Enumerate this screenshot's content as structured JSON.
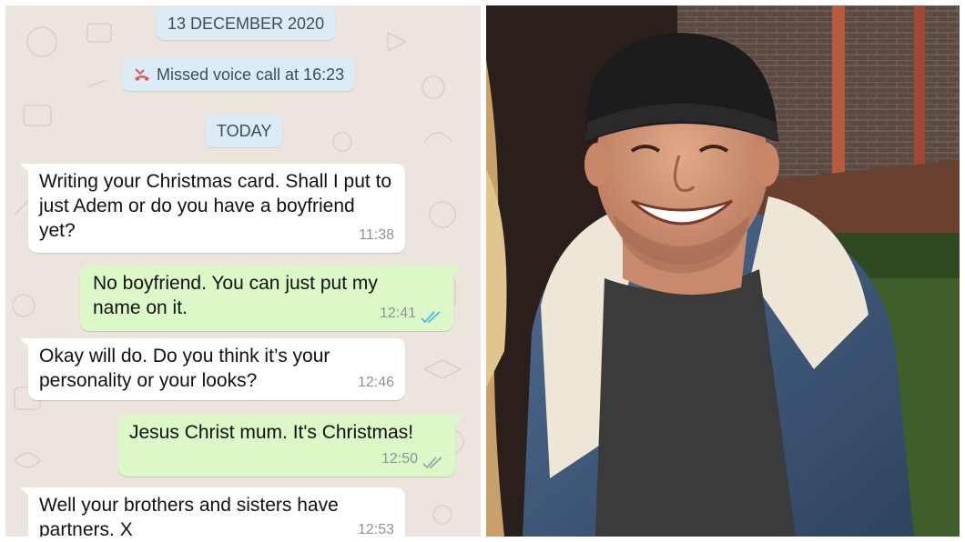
{
  "chat": {
    "date_separator": "13 DECEMBER 2020",
    "missed_call": "Missed voice call at 16:23",
    "today_separator": "TODAY",
    "messages": [
      {
        "direction": "incoming",
        "text": "Writing your Christmas card. Shall I put to just Adem or do you have a boyfriend yet?",
        "time": "11:38"
      },
      {
        "direction": "outgoing",
        "text": "No boyfriend. You can just put my name on it.",
        "time": "12:41",
        "status": "read"
      },
      {
        "direction": "incoming",
        "text": "Okay will do. Do you think it’s your personality or your looks?",
        "time": "12:46"
      },
      {
        "direction": "outgoing",
        "text": "Jesus Christ mum. It's Christmas!",
        "time": "12:50",
        "status": "delivered"
      },
      {
        "direction": "incoming",
        "text": "Well your brothers and sisters have partners. X",
        "time": "12:53"
      }
    ],
    "colors": {
      "wallpaper": "#ece5dd",
      "incoming_bubble": "#ffffff",
      "outgoing_bubble": "#dcf8c6",
      "system_pill": "#dcebf6",
      "read_tick": "#4fb6ec",
      "missed_call_icon": "#e35a5a"
    }
  },
  "photo": {
    "subject": "smiling man in black beanie and denim sherpa-collar jacket"
  }
}
